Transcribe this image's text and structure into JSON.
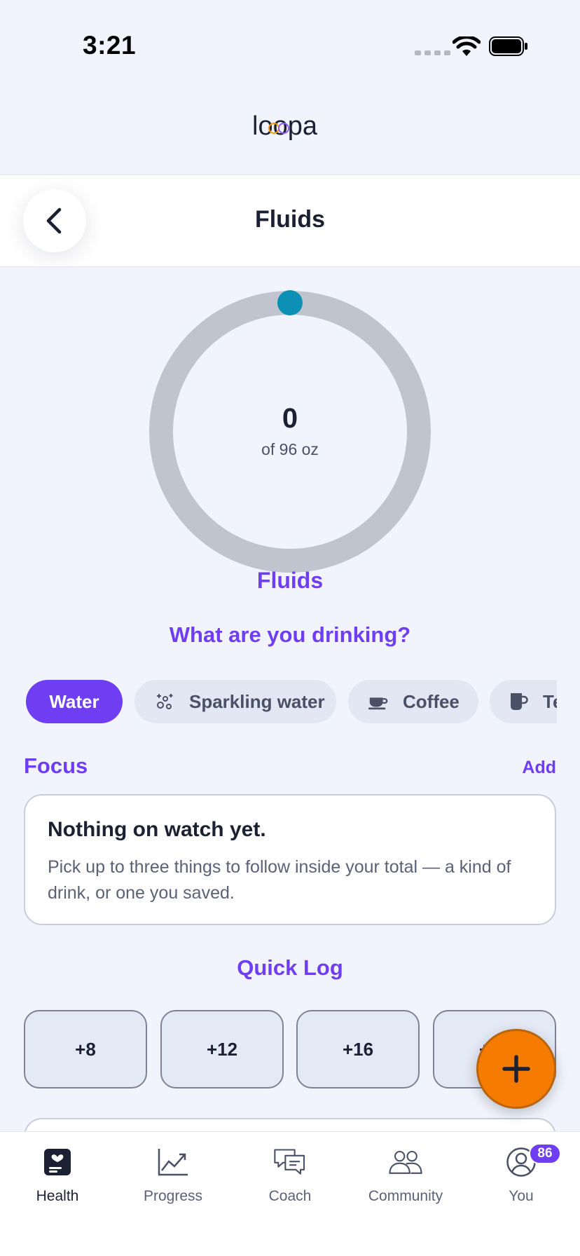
{
  "status_bar": {
    "time": "3:21"
  },
  "brand": {
    "logo_text": "loopa"
  },
  "header": {
    "title": "Fluids"
  },
  "progress": {
    "value": "0",
    "goal_text": "of 96 oz",
    "label": "Fluids",
    "fraction": 0,
    "track_color": "#c0c4ce",
    "indicator_color": "#0b8fb4"
  },
  "drink_picker": {
    "question": "What are you drinking?",
    "chips": [
      {
        "label": "Water",
        "selected": true
      },
      {
        "label": "Sparkling water",
        "icon": "sparkles-icon"
      },
      {
        "label": "Coffee",
        "icon": "coffee-cup-icon"
      },
      {
        "label": "Tea",
        "icon": "mug-icon"
      }
    ]
  },
  "focus": {
    "title": "Focus",
    "add_label": "Add",
    "empty_title": "Nothing on watch yet.",
    "empty_body": "Pick up to three things to follow inside your total — a kind of drink, or one you saved."
  },
  "quick_log": {
    "title": "Quick Log",
    "buttons": [
      "+8",
      "+12",
      "+16",
      "+20"
    ]
  },
  "fab": {
    "icon": "plus-icon",
    "color": "#f57c00"
  },
  "tab_bar": {
    "tabs": [
      {
        "label": "Health",
        "icon": "health-icon",
        "active": true
      },
      {
        "label": "Progress",
        "icon": "chart-icon"
      },
      {
        "label": "Coach",
        "icon": "chat-icon"
      },
      {
        "label": "Community",
        "icon": "people-icon"
      },
      {
        "label": "You",
        "icon": "profile-icon",
        "badge": "86"
      }
    ]
  },
  "colors": {
    "accent": "#6f3ef2",
    "background": "#f1f4fd"
  }
}
